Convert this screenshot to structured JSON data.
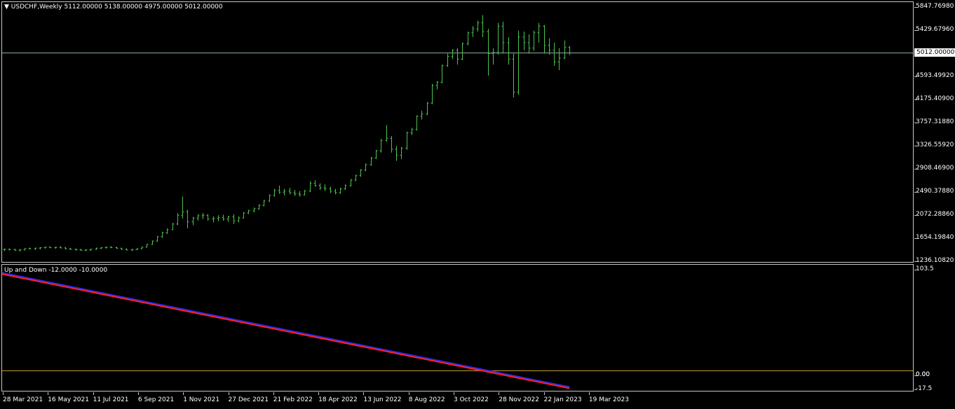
{
  "main": {
    "title_arrow": "▼",
    "symbol_line": "USDCHF,Weekly  5112.00000 5138.00000 4975.00000 5012.00000",
    "price_ticks": [
      "5847.76980",
      "5429.67960",
      "5012.00000",
      "4593.49920",
      "4175.40900",
      "3757.31880",
      "3326.55920",
      "2908.46900",
      "2490.37880",
      "2072.28860",
      "1654.19840",
      "1236.10820"
    ],
    "current_price_tag": "5012.00000",
    "bar_color": "#4cc34c",
    "price_line_color": "#8fb3b3"
  },
  "indicator": {
    "title": "Up and Down -12.0000 -10.0000",
    "ticks": [
      "103.5",
      "0.00",
      "0.00",
      "-17.5"
    ],
    "up_color": "#2a2ae6",
    "down_color": "#ff2020",
    "zero_line_color": "#c8a032"
  },
  "x_axis": {
    "labels": [
      "28 Mar 2021",
      "16 May 2021",
      "11 Jul 2021",
      "6 Sep 2021",
      "1 Nov 2021",
      "27 Dec 2021",
      "21 Feb 2022",
      "18 Apr 2022",
      "13 Jun 2022",
      "8 Aug 2022",
      "3 Oct 2022",
      "28 Nov 2022",
      "22 Jan 2023",
      "19 Mar 2023"
    ]
  },
  "chart_data": {
    "type": "ohlc",
    "ylim": [
      1236.1082,
      5847.7698
    ],
    "bars": [
      [
        1436,
        1456,
        1410,
        1440
      ],
      [
        1440,
        1452,
        1420,
        1438
      ],
      [
        1438,
        1450,
        1412,
        1425
      ],
      [
        1425,
        1444,
        1400,
        1432
      ],
      [
        1432,
        1460,
        1420,
        1455
      ],
      [
        1455,
        1470,
        1438,
        1450
      ],
      [
        1450,
        1468,
        1430,
        1462
      ],
      [
        1462,
        1478,
        1440,
        1470
      ],
      [
        1470,
        1490,
        1455,
        1480
      ],
      [
        1480,
        1492,
        1462,
        1470
      ],
      [
        1470,
        1488,
        1450,
        1476
      ],
      [
        1476,
        1494,
        1458,
        1466
      ],
      [
        1466,
        1480,
        1436,
        1450
      ],
      [
        1450,
        1465,
        1430,
        1440
      ],
      [
        1440,
        1455,
        1418,
        1432
      ],
      [
        1432,
        1448,
        1412,
        1424
      ],
      [
        1424,
        1442,
        1405,
        1430
      ],
      [
        1430,
        1450,
        1412,
        1442
      ],
      [
        1442,
        1470,
        1430,
        1460
      ],
      [
        1460,
        1480,
        1446,
        1470
      ],
      [
        1470,
        1490,
        1452,
        1478
      ],
      [
        1478,
        1495,
        1460,
        1472
      ],
      [
        1472,
        1488,
        1450,
        1458
      ],
      [
        1458,
        1470,
        1430,
        1440
      ],
      [
        1440,
        1458,
        1420,
        1428
      ],
      [
        1428,
        1448,
        1410,
        1436
      ],
      [
        1436,
        1460,
        1424,
        1452
      ],
      [
        1452,
        1490,
        1440,
        1480
      ],
      [
        1480,
        1540,
        1470,
        1530
      ],
      [
        1530,
        1600,
        1520,
        1590
      ],
      [
        1590,
        1680,
        1580,
        1670
      ],
      [
        1670,
        1760,
        1650,
        1740
      ],
      [
        1740,
        1820,
        1720,
        1800
      ],
      [
        1800,
        1920,
        1790,
        1900
      ],
      [
        1900,
        2100,
        1880,
        2060
      ],
      [
        2060,
        2400,
        2000,
        2120
      ],
      [
        2120,
        2160,
        1820,
        1940
      ],
      [
        1940,
        2030,
        1880,
        2010
      ],
      [
        2010,
        2080,
        1960,
        2050
      ],
      [
        2050,
        2100,
        1990,
        2060
      ],
      [
        2060,
        2080,
        1960,
        1990
      ],
      [
        1990,
        2040,
        1930,
        2000
      ],
      [
        2000,
        2060,
        1950,
        2020
      ],
      [
        2020,
        2070,
        1960,
        1990
      ],
      [
        1990,
        2050,
        1940,
        2030
      ],
      [
        2030,
        2080,
        1900,
        1960
      ],
      [
        1960,
        2040,
        1930,
        2010
      ],
      [
        2010,
        2120,
        2000,
        2100
      ],
      [
        2100,
        2160,
        2080,
        2140
      ],
      [
        2140,
        2200,
        2110,
        2180
      ],
      [
        2180,
        2260,
        2160,
        2240
      ],
      [
        2240,
        2340,
        2220,
        2320
      ],
      [
        2320,
        2440,
        2300,
        2420
      ],
      [
        2420,
        2540,
        2400,
        2510
      ],
      [
        2510,
        2600,
        2450,
        2480
      ],
      [
        2480,
        2540,
        2420,
        2500
      ],
      [
        2500,
        2560,
        2440,
        2470
      ],
      [
        2470,
        2520,
        2410,
        2450
      ],
      [
        2450,
        2500,
        2400,
        2430
      ],
      [
        2430,
        2520,
        2420,
        2500
      ],
      [
        2500,
        2680,
        2480,
        2640
      ],
      [
        2640,
        2700,
        2580,
        2600
      ],
      [
        2600,
        2640,
        2520,
        2560
      ],
      [
        2560,
        2620,
        2500,
        2540
      ],
      [
        2540,
        2580,
        2460,
        2500
      ],
      [
        2500,
        2540,
        2440,
        2470
      ],
      [
        2470,
        2560,
        2450,
        2540
      ],
      [
        2540,
        2620,
        2520,
        2600
      ],
      [
        2600,
        2720,
        2580,
        2700
      ],
      [
        2700,
        2800,
        2680,
        2780
      ],
      [
        2780,
        2900,
        2760,
        2880
      ],
      [
        2880,
        3000,
        2860,
        2980
      ],
      [
        2980,
        3120,
        2960,
        3100
      ],
      [
        3100,
        3250,
        3080,
        3230
      ],
      [
        3230,
        3450,
        3200,
        3420
      ],
      [
        3420,
        3700,
        3400,
        3460
      ],
      [
        3460,
        3500,
        3200,
        3260
      ],
      [
        3260,
        3320,
        3050,
        3150
      ],
      [
        3150,
        3300,
        3080,
        3280
      ],
      [
        3280,
        3580,
        3250,
        3560
      ],
      [
        3560,
        3650,
        3520,
        3620
      ],
      [
        3620,
        3880,
        3600,
        3860
      ],
      [
        3860,
        3960,
        3800,
        3900
      ],
      [
        3900,
        4120,
        3880,
        4100
      ],
      [
        4100,
        4450,
        4080,
        4420
      ],
      [
        4420,
        4500,
        4350,
        4480
      ],
      [
        4480,
        4800,
        4460,
        4780
      ],
      [
        4780,
        5000,
        4760,
        4950
      ],
      [
        4950,
        5080,
        4900,
        5060
      ],
      [
        5060,
        5100,
        4800,
        4900
      ],
      [
        4900,
        5200,
        4880,
        5180
      ],
      [
        5180,
        5400,
        5150,
        5380
      ],
      [
        5380,
        5500,
        5300,
        5450
      ],
      [
        5450,
        5600,
        5400,
        5560
      ],
      [
        5560,
        5700,
        5300,
        5400
      ],
      [
        5400,
        5450,
        4600,
        5000
      ],
      [
        5000,
        5100,
        4800,
        5020
      ],
      [
        5020,
        5560,
        4980,
        5500
      ],
      [
        5500,
        5580,
        5000,
        5200
      ],
      [
        5200,
        5300,
        4800,
        4900
      ],
      [
        4900,
        5000,
        4200,
        4300
      ],
      [
        4300,
        5420,
        4250,
        5300
      ],
      [
        5300,
        5400,
        5060,
        5200
      ],
      [
        5200,
        5350,
        5000,
        5100
      ],
      [
        5100,
        5420,
        5050,
        5380
      ],
      [
        5380,
        5560,
        5200,
        5500
      ],
      [
        5500,
        5520,
        5000,
        5150
      ],
      [
        5150,
        5280,
        4980,
        5060
      ],
      [
        5060,
        5200,
        4780,
        4850
      ],
      [
        4850,
        5100,
        4700,
        4920
      ],
      [
        4920,
        5240,
        4900,
        5112
      ],
      [
        5112,
        5138,
        4975,
        5012
      ]
    ],
    "indicator_range": [
      -17.5,
      103.5
    ],
    "indicator_up": {
      "start": 103.5,
      "end": -17.5
    },
    "indicator_down": {
      "start": 102.5,
      "end": -18.5
    }
  }
}
